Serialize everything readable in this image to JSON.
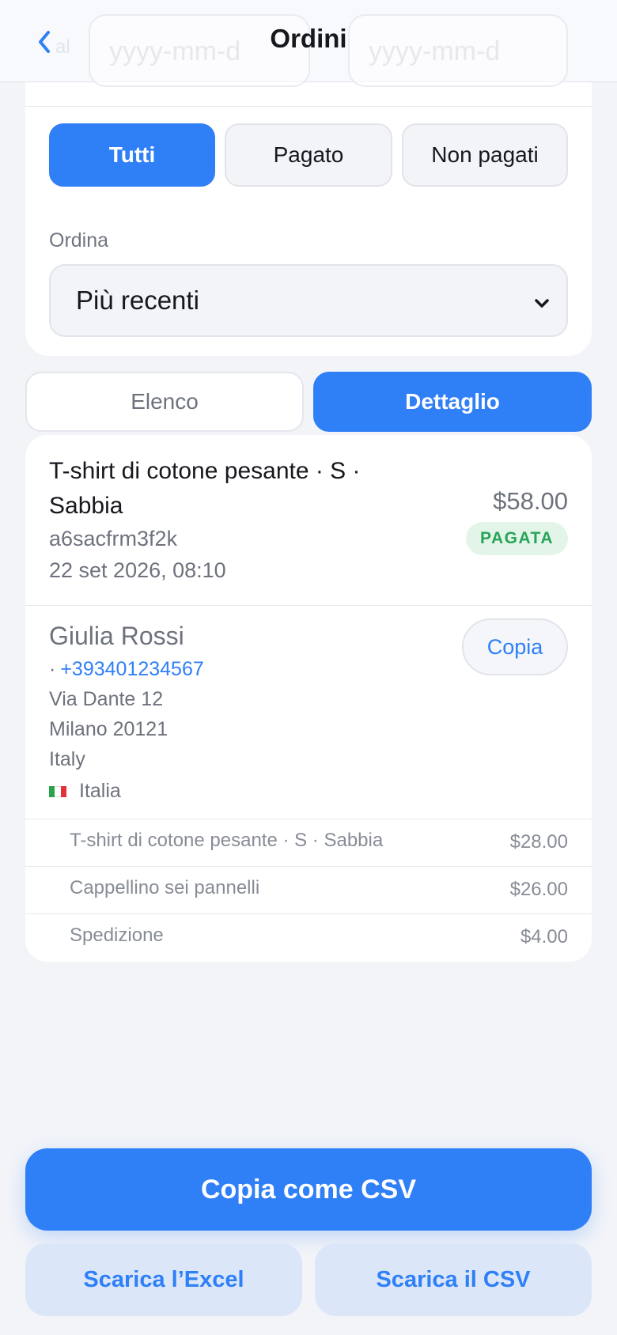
{
  "header": {
    "title": "Ordini",
    "back_icon": "chevron-left-icon",
    "ghost_label": "al",
    "ghost_date_from": "yyyy-mm-d",
    "ghost_date_to": "yyyy-mm-d"
  },
  "filters": {
    "payment": [
      {
        "label": "Tutti",
        "active": true
      },
      {
        "label": "Pagato",
        "active": false
      },
      {
        "label": "Non pagati",
        "active": false
      }
    ],
    "sort_label": "Ordina",
    "sort_value": "Più recenti"
  },
  "view_tabs": {
    "list": "Elenco",
    "detail": "Dettaglio",
    "active": "detail"
  },
  "order": {
    "product": "T-shirt di cotone pesante · S · Sabbia",
    "id": "a6sacfrm3f2k",
    "date": "22 set 2026, 08:10",
    "total": "$58.00",
    "status": "PAGATA",
    "customer": {
      "name": "Giulia Rossi",
      "phone_prefix": "·",
      "phone": "+393401234567",
      "address_line1": "Via Dante 12",
      "address_line2": "Milano 20121",
      "address_country": "Italy",
      "country": "Italia",
      "flag_icon": "italy-flag-icon"
    },
    "copy_label": "Copia",
    "items": [
      {
        "name": "T-shirt di cotone pesante · S · Sabbia",
        "price": "$28.00"
      },
      {
        "name": "Cappellino sei pannelli",
        "price": "$26.00"
      },
      {
        "name": "Spedizione",
        "price": "$4.00"
      }
    ]
  },
  "actions": {
    "copy_csv": "Copia come CSV",
    "download_excel": "Scarica l’Excel",
    "download_csv": "Scarica il CSV"
  },
  "colors": {
    "accent": "#2f7ff7",
    "paid_badge_bg": "#e3f5e9",
    "paid_badge_text": "#28a458",
    "background": "#f2f4f8"
  }
}
